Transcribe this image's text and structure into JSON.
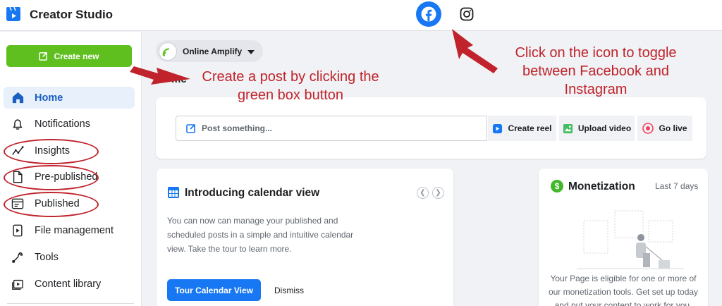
{
  "app": {
    "title": "Creator Studio"
  },
  "topbar": {
    "facebook_icon": "facebook-icon",
    "instagram_icon": "instagram-icon"
  },
  "sidebar": {
    "create_label": "Create new",
    "items": [
      {
        "label": "Home",
        "icon": "home-icon"
      },
      {
        "label": "Notifications",
        "icon": "bell-icon"
      },
      {
        "label": "Insights",
        "icon": "insights-icon"
      },
      {
        "label": "Pre-published",
        "icon": "document-icon"
      },
      {
        "label": "Published",
        "icon": "published-icon"
      },
      {
        "label": "File management",
        "icon": "file-video-icon"
      },
      {
        "label": "Tools",
        "icon": "tools-icon"
      },
      {
        "label": "Content library",
        "icon": "library-icon"
      }
    ]
  },
  "page_selector": {
    "name": "Online Amplify"
  },
  "header_partial": "me",
  "post": {
    "placeholder": "Post something...",
    "actions": [
      {
        "label": "Create reel",
        "icon": "reel-icon",
        "color": "#1877f2"
      },
      {
        "label": "Upload video",
        "icon": "photo-video-icon",
        "color": "#45bd62"
      },
      {
        "label": "Go live",
        "icon": "live-icon",
        "color": "#f3425f"
      }
    ]
  },
  "calendar_card": {
    "title": "Introducing calendar view",
    "description": "You can now can manage your published and scheduled posts in a simple and intuitive calendar view. Take the tour to learn more.",
    "primary_button": "Tour Calendar View",
    "secondary_button": "Dismiss"
  },
  "monetization": {
    "icon_glyph": "$",
    "title": "Monetization",
    "period": "Last 7 days",
    "description": "Your Page is eligible for one or more of our monetization tools. Get set up today and put your content to work for you."
  },
  "annotations": {
    "create_post": "Create a post by clicking the green box button",
    "toggle": "Click on the icon to toggle between Facebook and Instagram"
  },
  "colors": {
    "accent_blue": "#1877f2",
    "create_green": "#5fbf1f",
    "annotation_red": "#c0232b"
  }
}
